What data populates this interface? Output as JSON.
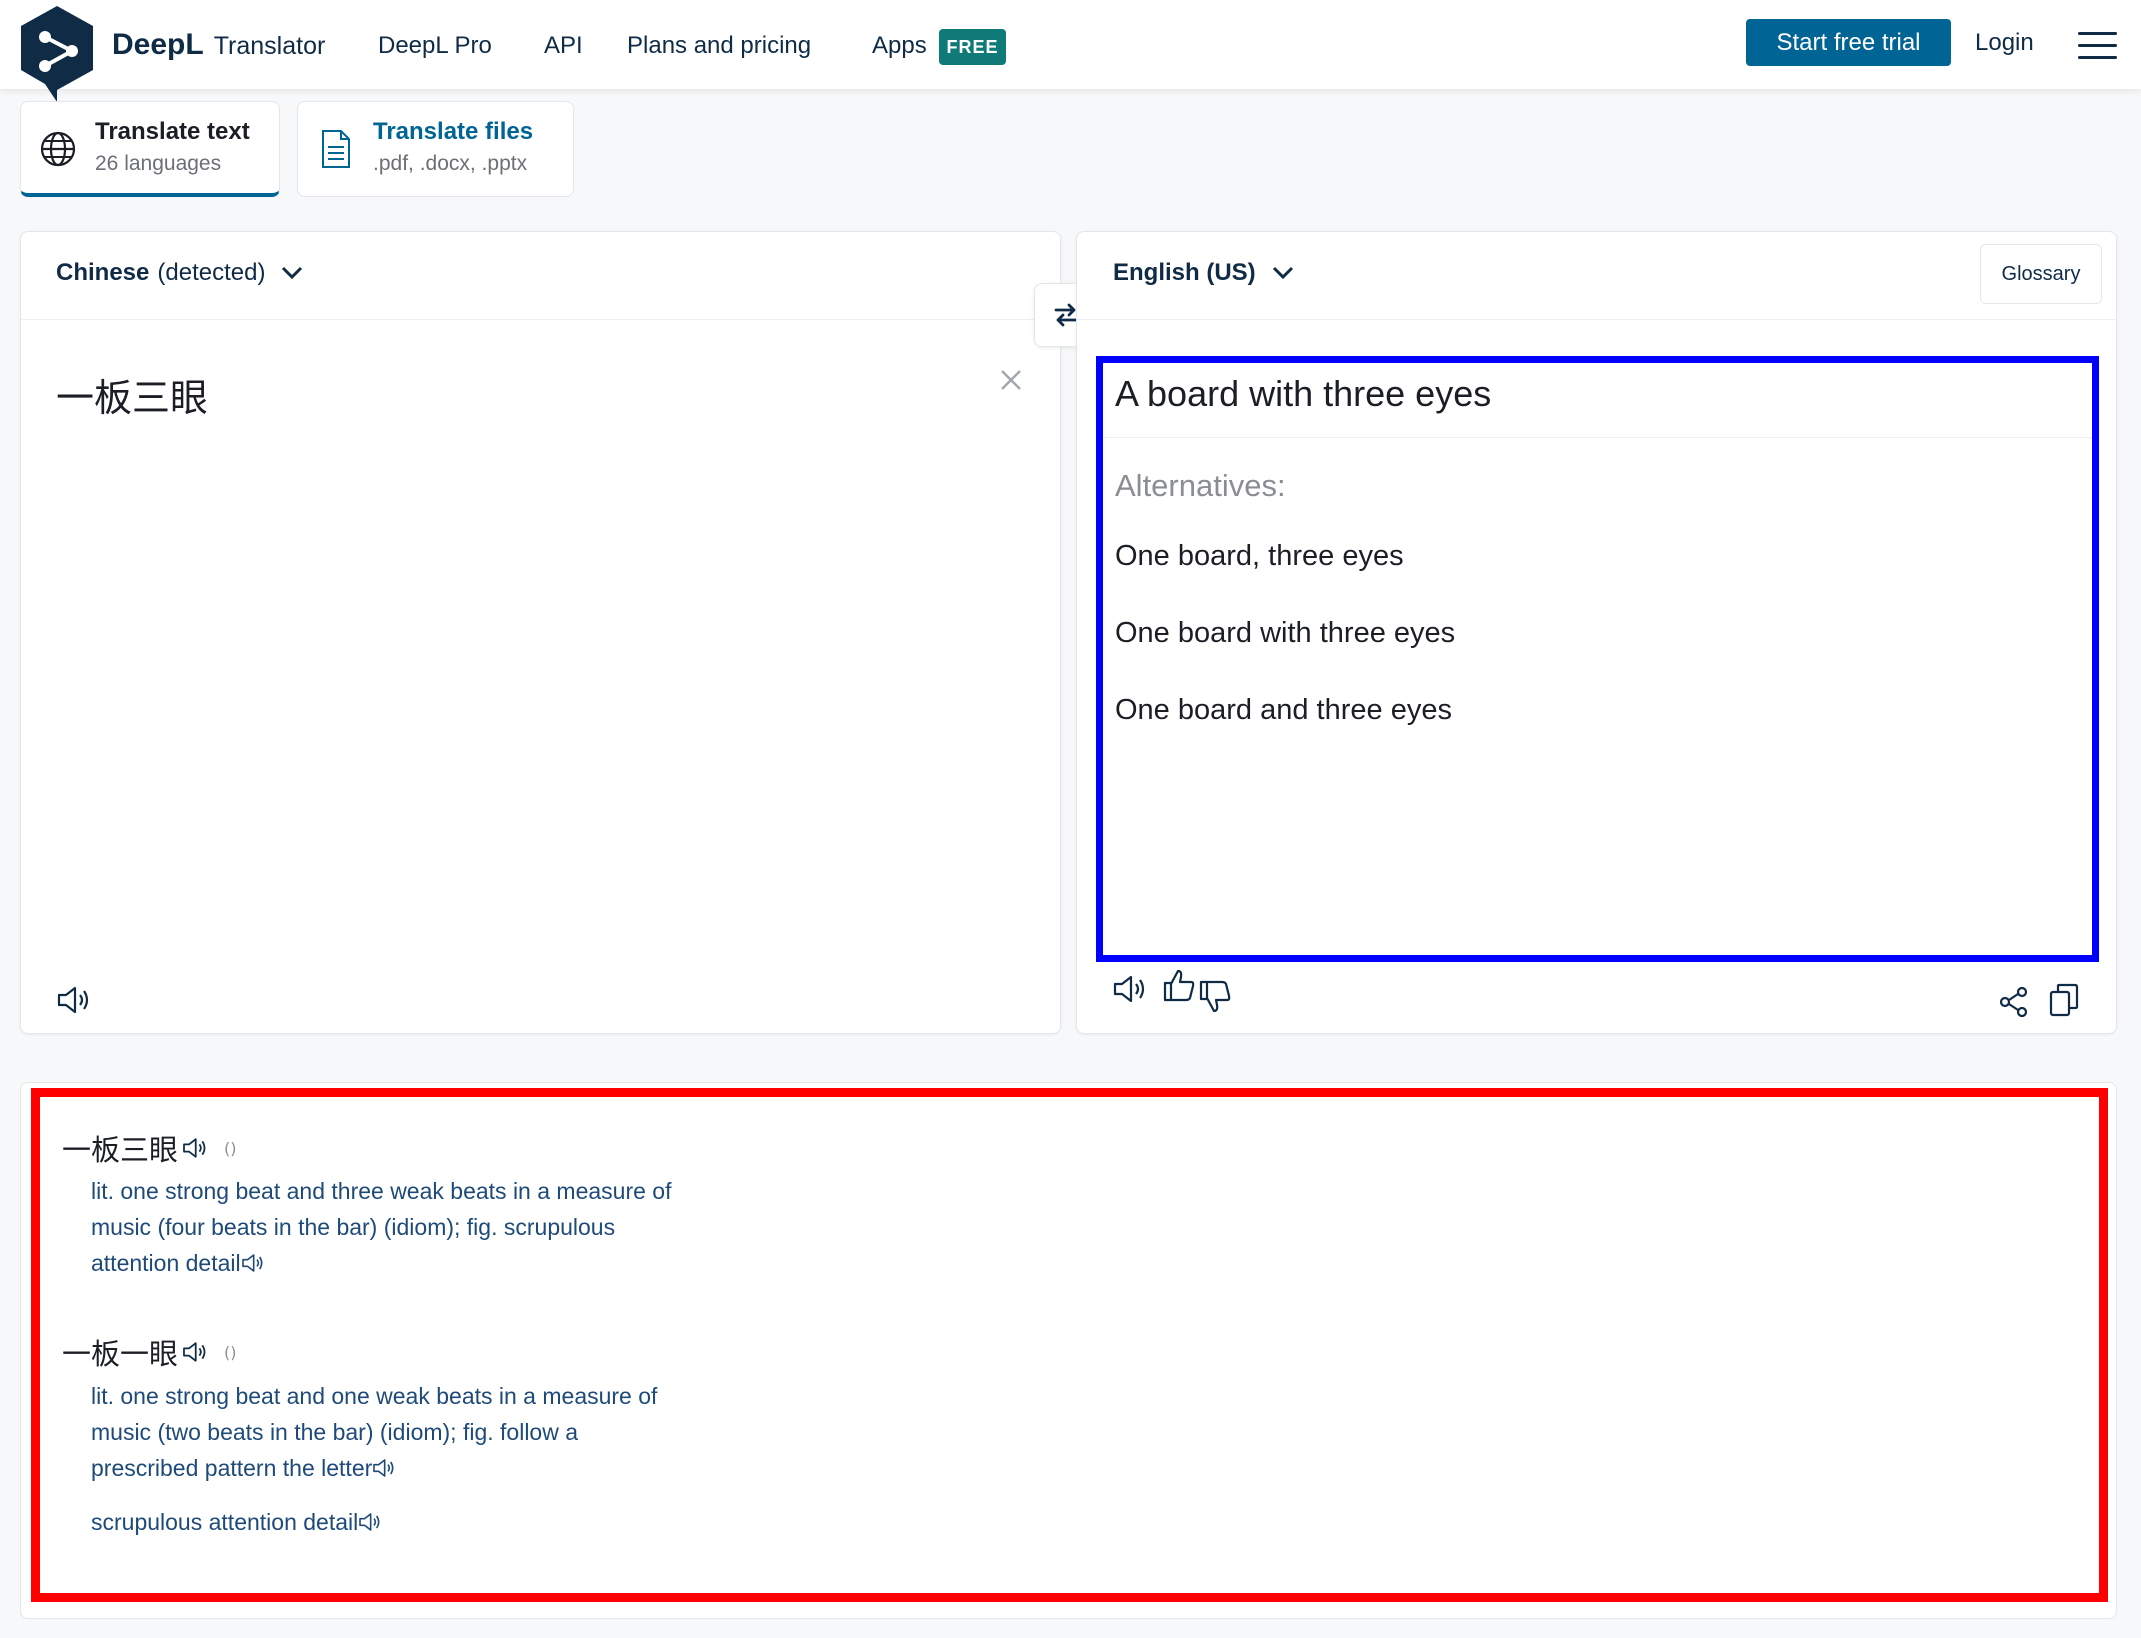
{
  "header": {
    "brand": "DeepL",
    "brand_sub": "Translator",
    "nav": [
      "DeepL Pro",
      "API",
      "Plans and pricing",
      "Apps"
    ],
    "badge": "FREE",
    "trial_button": "Start free trial",
    "login": "Login",
    "menu_icon": "hamburger-icon"
  },
  "mode_tabs": {
    "text": {
      "title": "Translate text",
      "subtitle": "26 languages",
      "icon": "globe-icon"
    },
    "files": {
      "title": "Translate files",
      "subtitle": ".pdf, .docx, .pptx",
      "icon": "document-icon"
    }
  },
  "source": {
    "language": "Chinese",
    "language_note": "(detected)",
    "text": "一板三眼"
  },
  "target": {
    "language": "English (US)",
    "glossary_button": "Glossary",
    "translation": "A board with three eyes",
    "alternatives_label": "Alternatives:",
    "alternatives": [
      "One board, three eyes",
      "One board with three eyes",
      "One board and three eyes"
    ]
  },
  "dictionary": {
    "entries": [
      {
        "term": "一板三眼",
        "paren": "()",
        "definitions": [
          [
            "lit. one strong beat and three weak beats in a measure of",
            "music (four beats in the bar) (idiom); fig. scrupulous",
            "attention detail"
          ]
        ]
      },
      {
        "term": "一板一眼",
        "paren": "()",
        "definitions": [
          [
            "lit. one strong beat and one weak beats in a measure of",
            "music (two beats in the bar) (idiom); fig. follow a",
            "prescribed pattern the letter"
          ],
          [
            "scrupulous attention detail"
          ]
        ]
      }
    ]
  },
  "colors": {
    "accent": "#006494",
    "brand": "#0f2b46",
    "badge": "#0f7a78",
    "highlight_output": "#0000ff",
    "highlight_dictionary": "#ff0000",
    "dictionary_text": "#1e4a7a"
  }
}
